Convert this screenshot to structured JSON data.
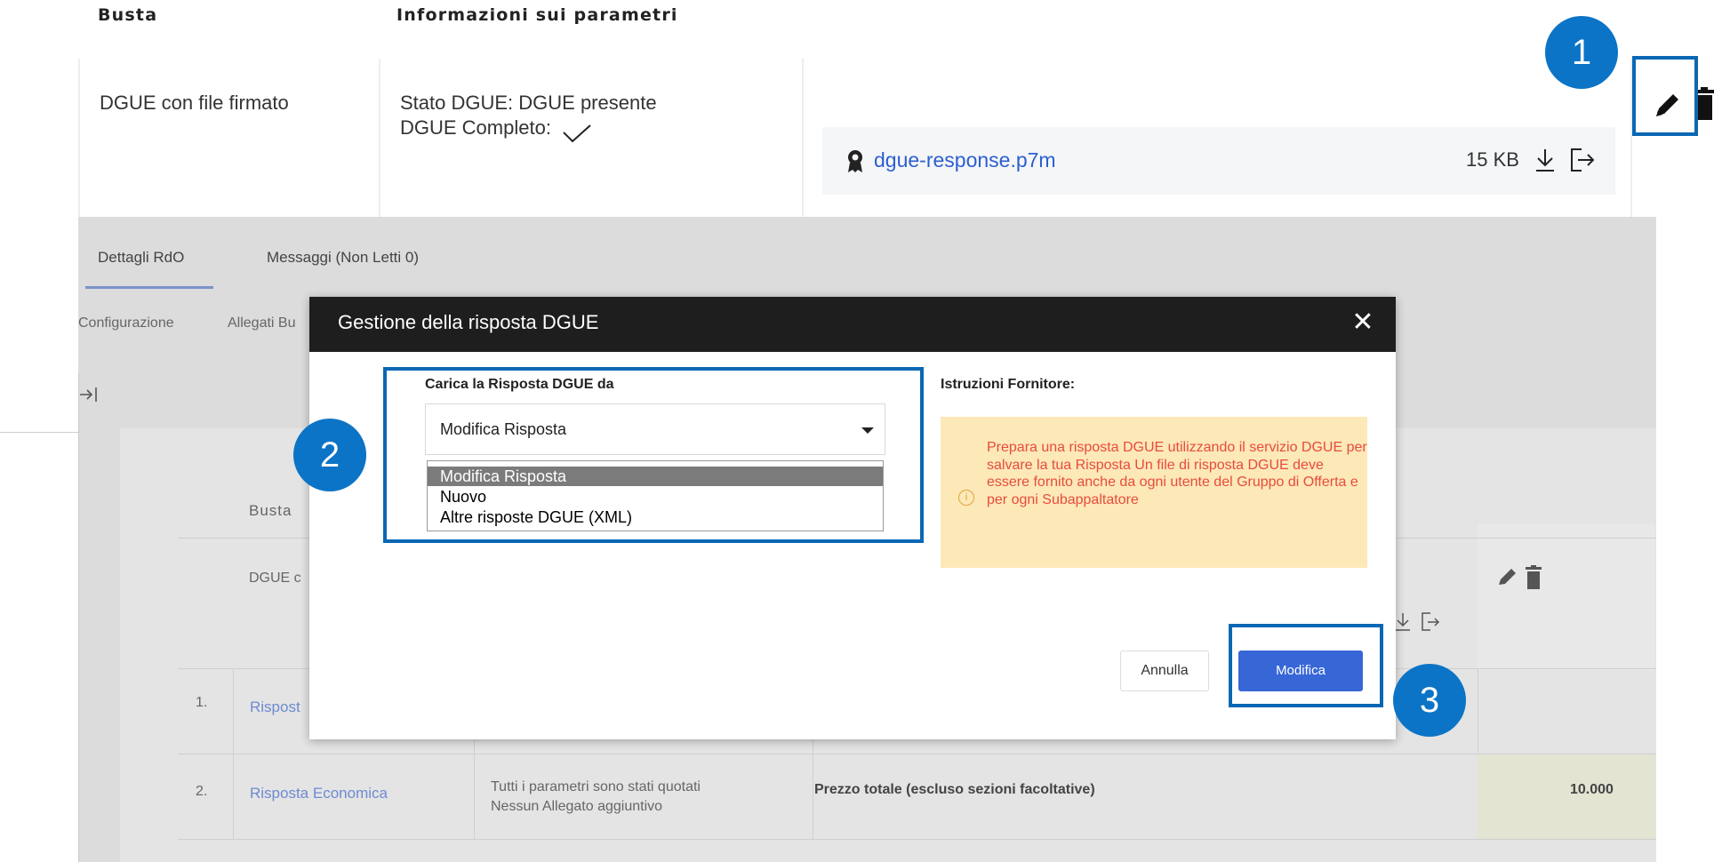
{
  "top": {
    "col_busta": "Busta",
    "col_info": "Informazioni sui parametri",
    "row_name": "DGUE con file firmato",
    "stato": "Stato DGUE: DGUE presente",
    "completo": "DGUE Completo:",
    "file_name": "dgue-response.p7m",
    "file_size": "15 KB"
  },
  "tabs": {
    "dettagli": "Dettagli RdO",
    "messaggi": "Messaggi (Non Letti 0)"
  },
  "subtabs": {
    "configurazione": "Configurazione",
    "allegati": "Allegati Bu"
  },
  "bg_table": {
    "header_busta": "Busta",
    "row0_name": "DGUE c",
    "rows": [
      {
        "num": "1.",
        "name": "Rispost"
      },
      {
        "num": "2.",
        "name": "Risposta Economica",
        "info1": "Tutti i parametri sono stati quotati",
        "info2": "Nessun Allegato aggiuntivo",
        "desc": "Prezzo totale (escluso sezioni facoltative)",
        "value": "10.000"
      }
    ]
  },
  "modal": {
    "title": "Gestione della risposta DGUE",
    "field_label": "Carica la Risposta DGUE da",
    "selected": "Modifica Risposta",
    "options": [
      "Modifica Risposta",
      "Nuovo",
      "Altre risposte DGUE (XML)"
    ],
    "instructions_label": "Istruzioni Fornitore:",
    "warning_text": "Prepara una risposta DGUE utilizzando il servizio DGUE per salvare la tua Risposta Un file di risposta DGUE deve essere fornito anche da ogni utente del Gruppo di Offerta e per ogni Subappaltatore",
    "cancel": "Annulla",
    "confirm": "Modifica"
  },
  "callouts": [
    "1",
    "2",
    "3"
  ],
  "colors": {
    "accent": "#0b74c6",
    "primary_button": "#3766d6",
    "link": "#2b5fd0",
    "warning_bg": "#fde8b8",
    "warning_text": "#e74c3c"
  }
}
